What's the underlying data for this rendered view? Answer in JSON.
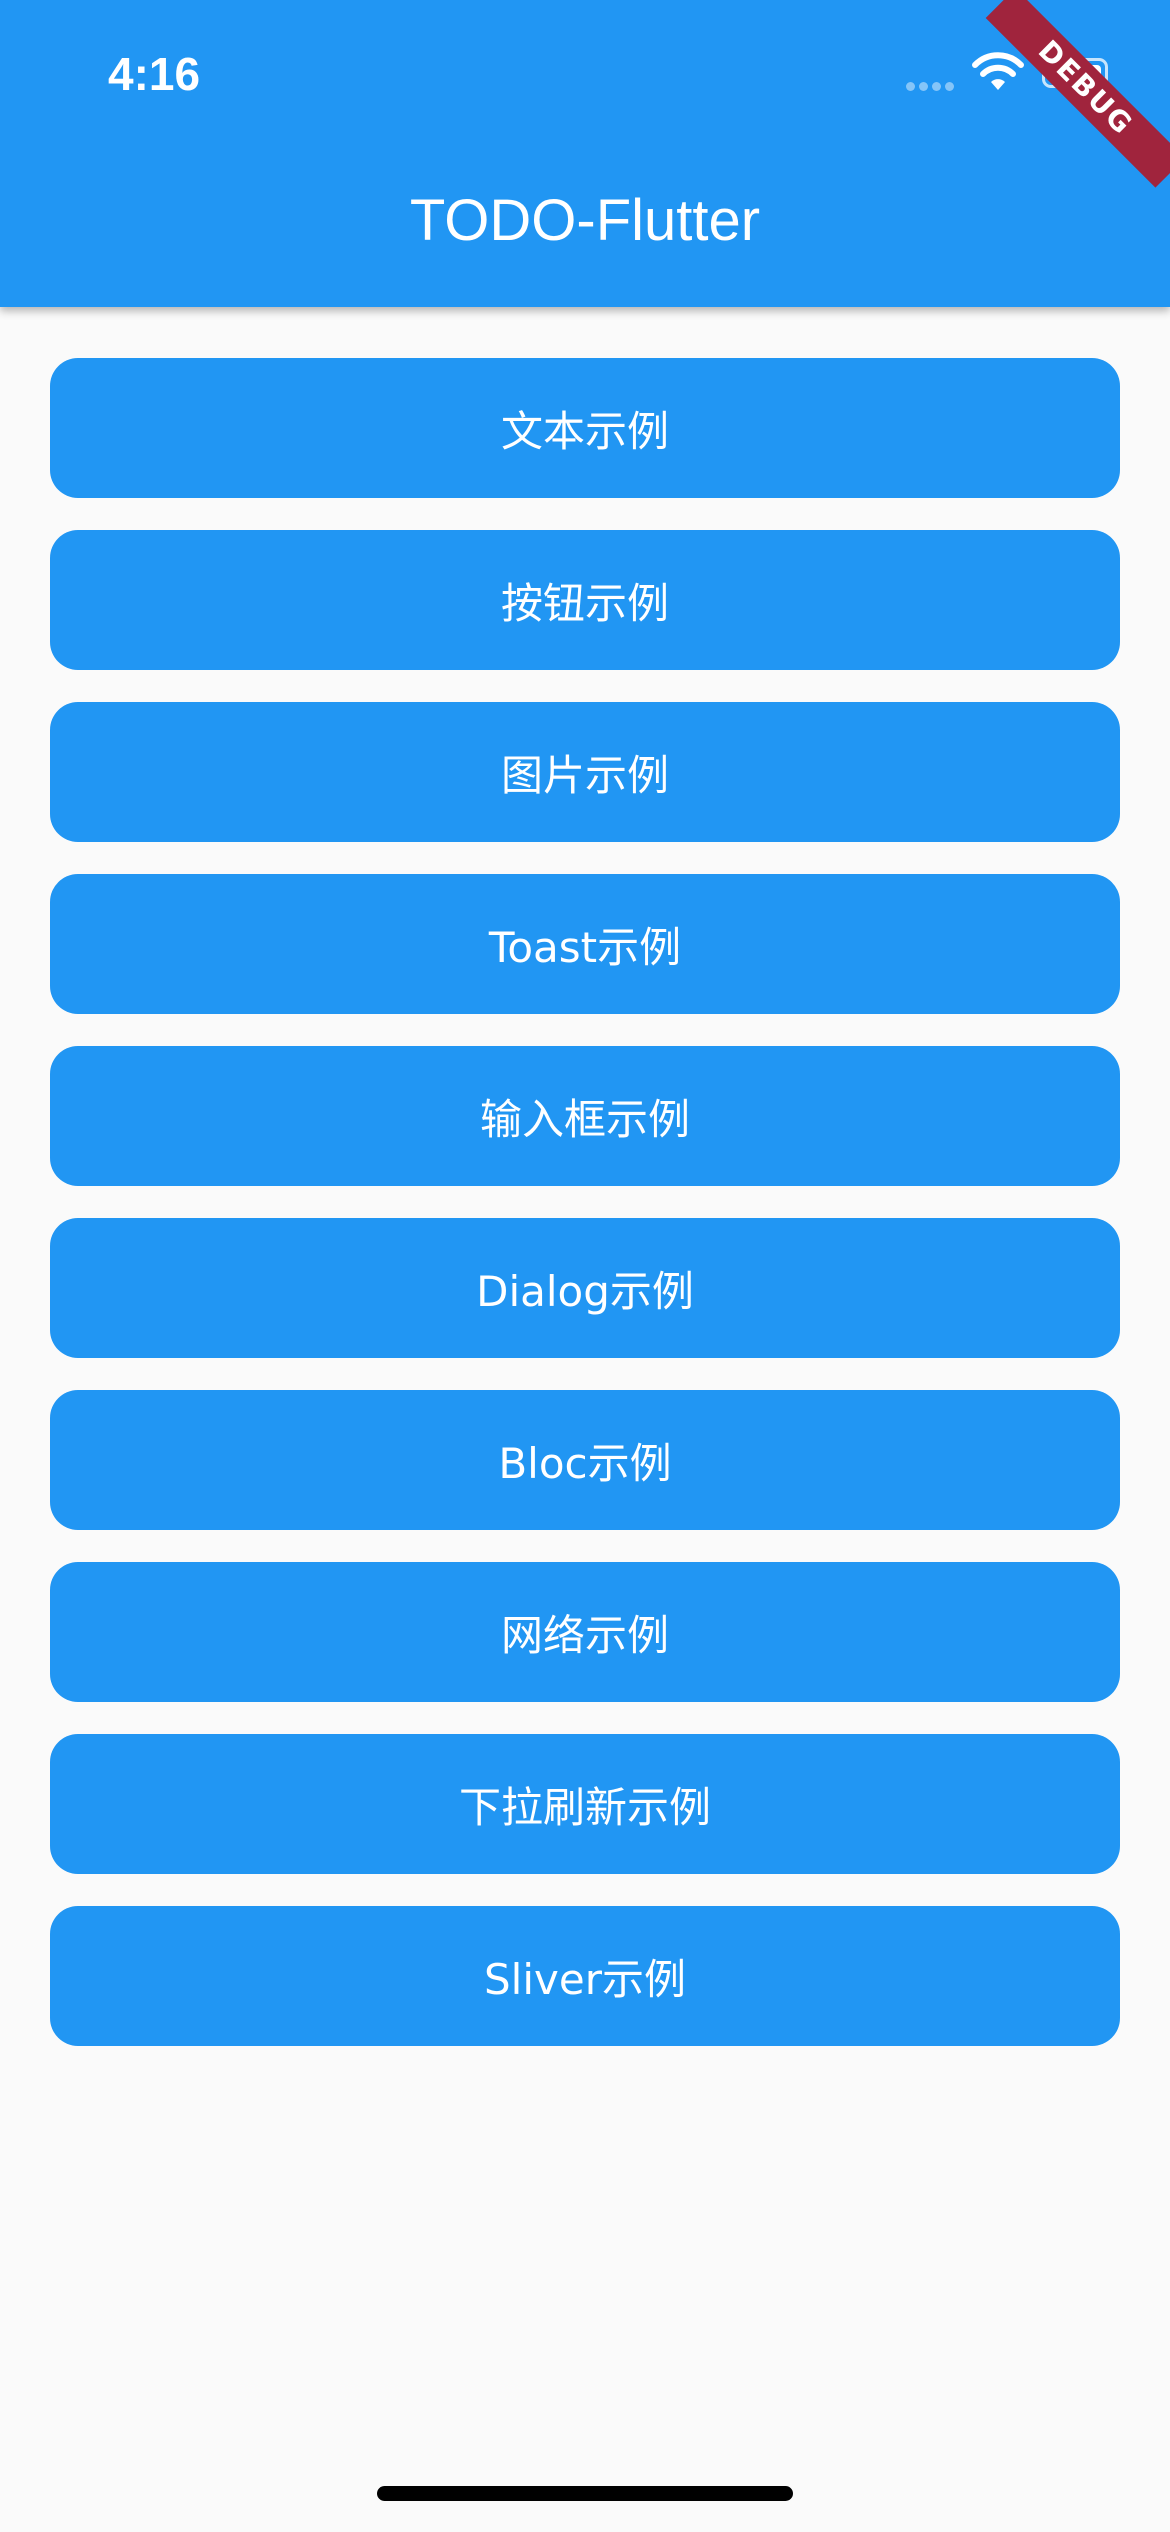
{
  "status_bar": {
    "time": "4:16"
  },
  "appbar": {
    "title": "TODO-Flutter",
    "color": "#2196F3"
  },
  "debug_banner": {
    "label": "DEBUG",
    "color": "#A0243D"
  },
  "menu": {
    "items": [
      {
        "label": "文本示例"
      },
      {
        "label": "按钮示例"
      },
      {
        "label": "图片示例"
      },
      {
        "label": "Toast示例"
      },
      {
        "label": "输入框示例"
      },
      {
        "label": "Dialog示例"
      },
      {
        "label": "Bloc示例"
      },
      {
        "label": "网络示例"
      },
      {
        "label": "下拉刷新示例"
      },
      {
        "label": "Sliver示例"
      }
    ]
  },
  "icons": {
    "signal": "cellular-signal-icon",
    "wifi": "wifi-icon",
    "battery": "battery-icon"
  }
}
